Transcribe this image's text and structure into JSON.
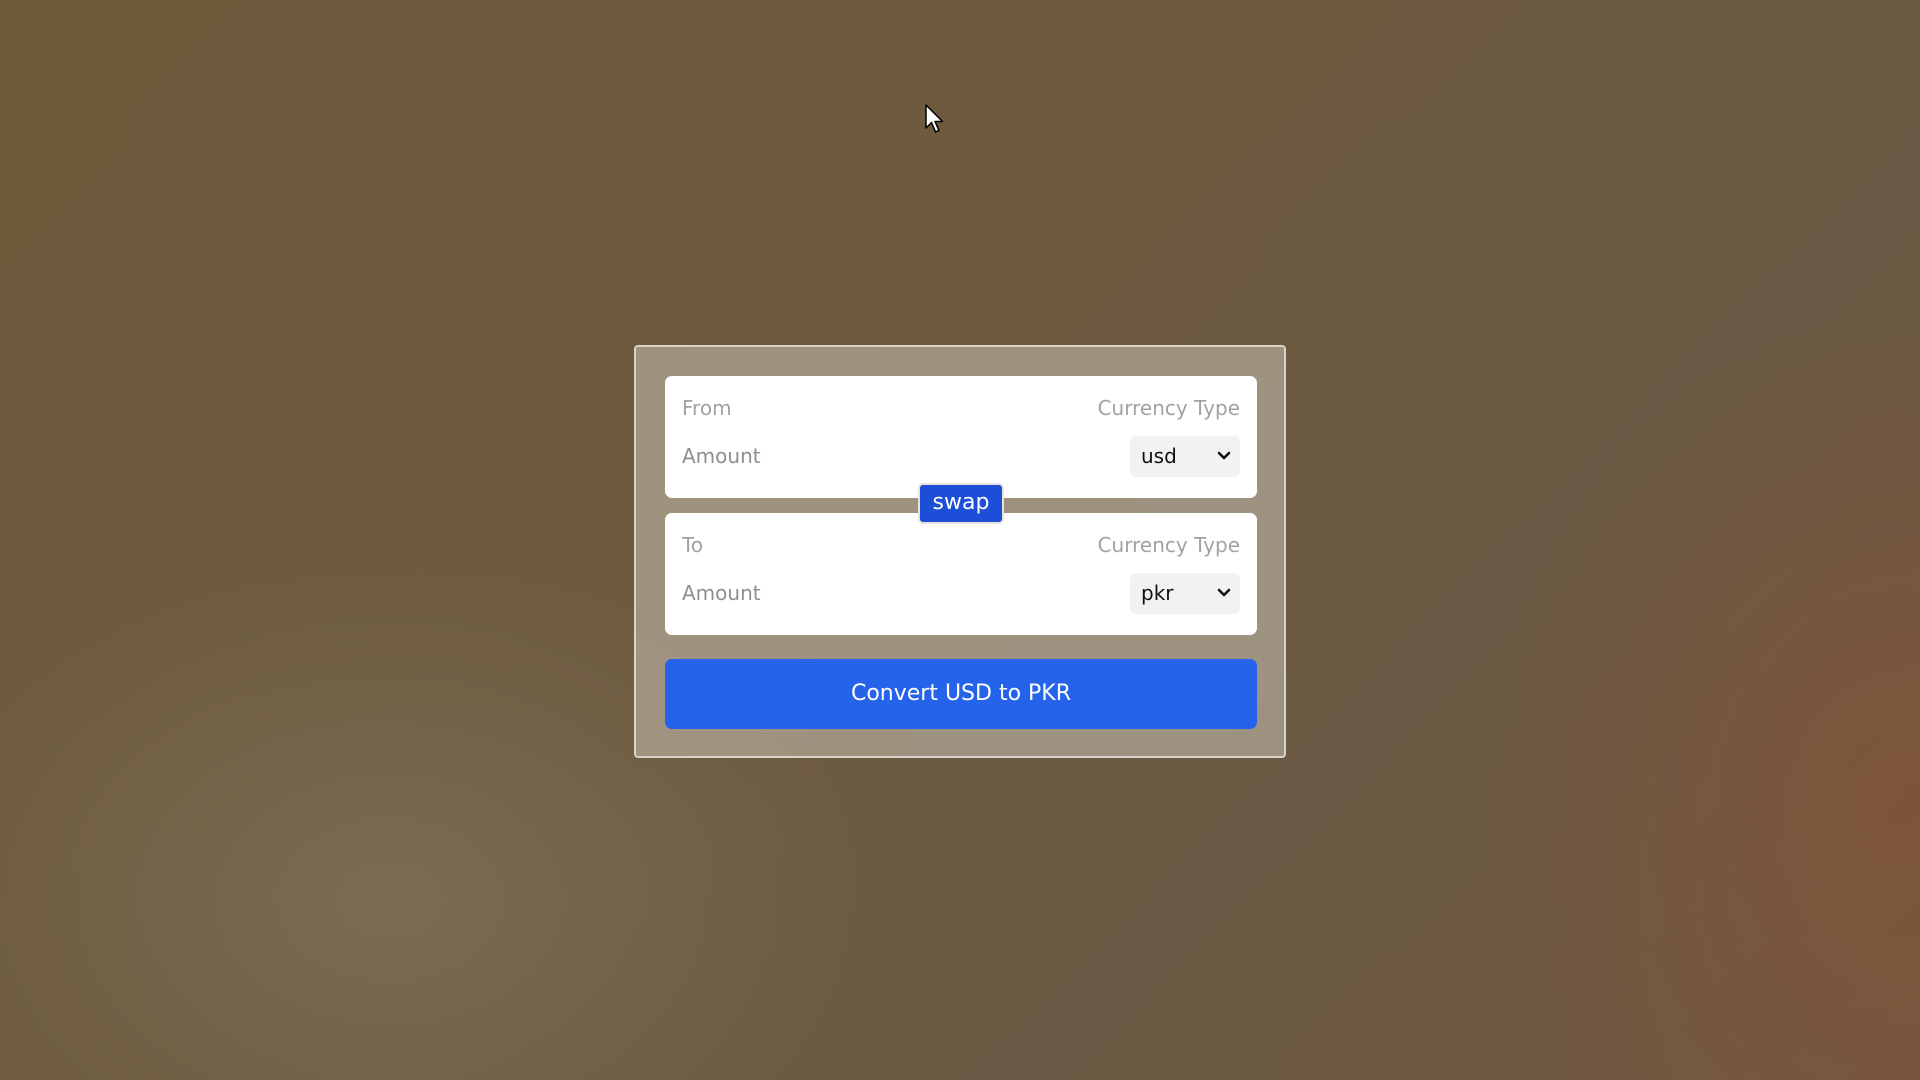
{
  "converter": {
    "from": {
      "label": "From",
      "currency_type_label": "Currency Type",
      "amount_label": "Amount",
      "selected_currency": "usd"
    },
    "to": {
      "label": "To",
      "currency_type_label": "Currency Type",
      "amount_label": "Amount",
      "selected_currency": "pkr"
    },
    "swap_label": "swap",
    "convert_label": "Convert USD to PKR"
  },
  "icons": {
    "cursor": "mouse-pointer-icon",
    "dropdown": "chevron-down-icon"
  },
  "colors": {
    "primary": "#2563eb",
    "swap": "#1d4ed8"
  }
}
